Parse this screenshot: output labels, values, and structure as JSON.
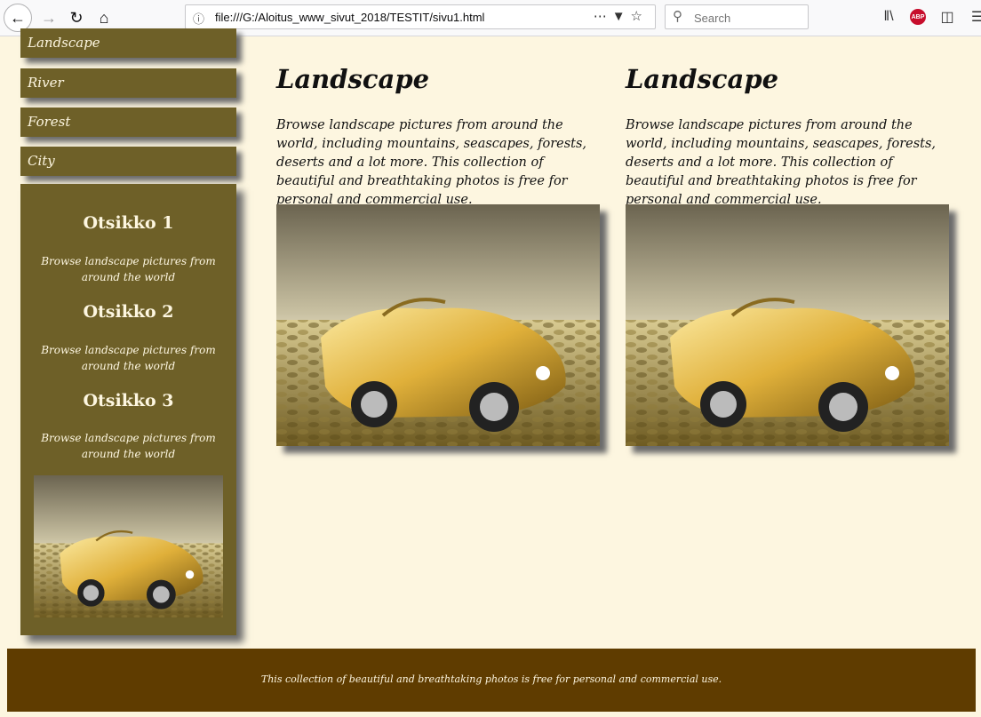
{
  "browser": {
    "url": "file:///G:/Aloitus_www_sivut_2018/TESTIT/sivu1.html",
    "search_placeholder": "Search",
    "icons": [
      "back-icon",
      "forward-icon",
      "reload-icon",
      "home-icon",
      "info-icon",
      "more-icon",
      "pocket-icon",
      "bookmark-star-icon",
      "search-icon",
      "library-icon",
      "adblock-icon",
      "sidebar-icon",
      "menu-icon"
    ],
    "abp_label": "ABP"
  },
  "sidebar": {
    "nav": [
      {
        "label": "Landscape"
      },
      {
        "label": "River"
      },
      {
        "label": "Forest"
      },
      {
        "label": "City"
      }
    ],
    "sections": [
      {
        "heading": "Otsikko 1",
        "text": "Browse landscape pictures from around the world"
      },
      {
        "heading": "Otsikko 2",
        "text": "Browse landscape pictures from around the world"
      },
      {
        "heading": "Otsikko 3",
        "text": "Browse landscape pictures from around the world"
      }
    ]
  },
  "main": {
    "columns": [
      {
        "title": "Landscape",
        "text": "Browse landscape pictures from around the world, including mountains, seascapes, forests, deserts and a lot more. This collection of beautiful and breathtaking photos is free for personal and commercial use."
      },
      {
        "title": "Landscape",
        "text": "Browse landscape pictures from around the world, including mountains, seascapes, forests, deserts and a lot more. This collection of beautiful and breathtaking photos is free for personal and commercial use."
      }
    ]
  },
  "footer": {
    "text": "This collection of beautiful and breathtaking photos is free for personal and commercial use."
  },
  "colors": {
    "page_bg": "#fdf6e0",
    "sidebar_bg": "#6e6028",
    "footer_bg": "#5f3c00",
    "shadow": "#6b6b6b"
  }
}
